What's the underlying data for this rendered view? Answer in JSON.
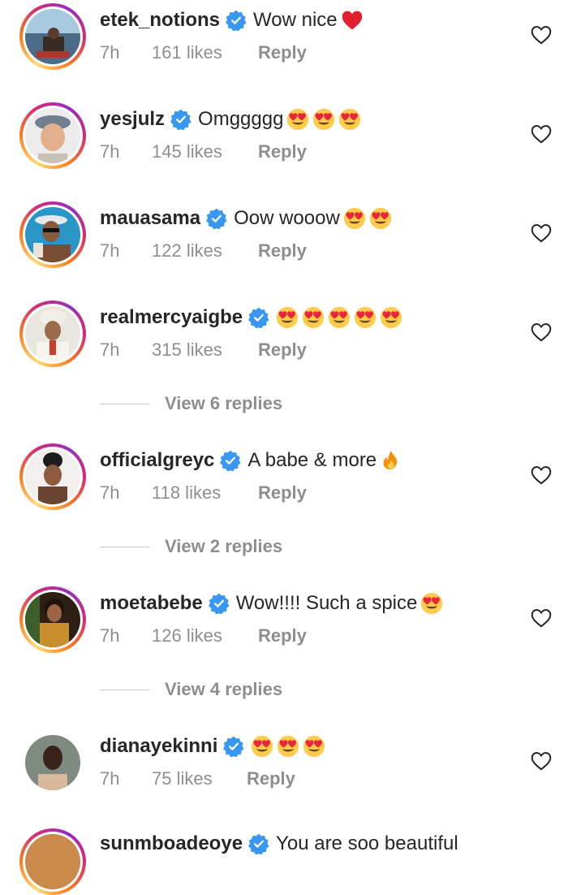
{
  "colors": {
    "text": "#262626",
    "muted": "#8e8e8e",
    "verified": "#3897f0",
    "story_ring_start": "#feda75",
    "story_ring_end": "#962fbf"
  },
  "icons": {
    "verified": "verified-badge-icon",
    "like": "heart-outline-icon",
    "red_heart_emoji": "red-heart-emoji",
    "heart_eyes_emoji": "heart-eyes-emoji",
    "fire_emoji": "fire-emoji"
  },
  "comments": [
    {
      "username": "etek_notions",
      "text": "Wow nice",
      "emojis": [
        "red-heart-emoji"
      ],
      "time": "7h",
      "likes": "161 likes",
      "reply": "Reply"
    },
    {
      "username": "yesjulz",
      "text": "Omggggg",
      "emojis": [
        "heart-eyes-emoji",
        "heart-eyes-emoji",
        "heart-eyes-emoji"
      ],
      "time": "7h",
      "likes": "145 likes",
      "reply": "Reply"
    },
    {
      "username": "mauasama",
      "text": "Oow wooow",
      "emojis": [
        "heart-eyes-emoji",
        "heart-eyes-emoji"
      ],
      "time": "7h",
      "likes": "122 likes",
      "reply": "Reply"
    },
    {
      "username": "realmercyaigbe",
      "text": "",
      "emojis": [
        "heart-eyes-emoji",
        "heart-eyes-emoji",
        "heart-eyes-emoji",
        "heart-eyes-emoji",
        "heart-eyes-emoji"
      ],
      "time": "7h",
      "likes": "315 likes",
      "reply": "Reply",
      "view_replies": "View 6 replies"
    },
    {
      "username": "officialgreyc",
      "text": "A babe & more",
      "emojis": [
        "fire-emoji"
      ],
      "time": "7h",
      "likes": "118 likes",
      "reply": "Reply",
      "view_replies": "View 2 replies"
    },
    {
      "username": "moetabebe",
      "text": "Wow!!!! Such a spice",
      "emojis": [
        "heart-eyes-emoji"
      ],
      "time": "7h",
      "likes": "126 likes",
      "reply": "Reply",
      "view_replies": "View 4 replies"
    },
    {
      "username": "dianayekinni",
      "text": "",
      "emojis": [
        "heart-eyes-emoji",
        "heart-eyes-emoji",
        "heart-eyes-emoji"
      ],
      "time": "7h",
      "likes": "75 likes",
      "reply": "Reply"
    },
    {
      "username": "sunmboadeoye",
      "text": "You are soo beautiful"
    }
  ]
}
